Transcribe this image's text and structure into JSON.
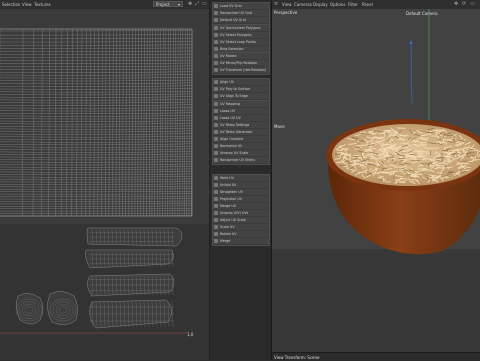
{
  "uv_editor": {
    "menu": [
      "Selection",
      "View",
      "Textures"
    ],
    "dropdown": "Project",
    "coordinate": "1,0"
  },
  "tool_groups": [
    [
      "Load UV Grid",
      "Randomize UV Grid",
      "Default UV Grid"
    ],
    [
      "UV Quickselect Polygons",
      "UV Select Polygons",
      "UV Select Loop Points",
      "Ring Selection"
    ],
    [
      "UV Rotate",
      "UV Mirror/Flip Rotation",
      "UV Transform (Hot Rotation)"
    ],
    [
      "Align UV",
      "UV Poly to Surface",
      "UV Align To Edge"
    ],
    [
      "UV Mapping",
      "Lasso UV",
      "Lasso UV UV",
      "UV Relax Settings",
      "UV Relax Generator",
      "Align Unrolled",
      "Normalize UV",
      "Unwrap UV Scale",
      "Randomize UV Shells"
    ],
    [
      "Weld UV",
      "Unfold UV",
      "Straighten UV",
      "Projection UV",
      "Merge UV",
      "Unwrap (UV) UVs",
      "Adjust UV Scale",
      "Scale UV",
      "Rotate UV",
      "Merge"
    ]
  ],
  "viewport": {
    "menu": [
      "View",
      "Cameras",
      "Display",
      "Options",
      "Filter",
      "Panel"
    ],
    "perspective_label": "Perspective",
    "camera_label": "Default Camera",
    "move_label": "Move",
    "status_text": "View Transform: Scene"
  },
  "colors": {
    "bowl": "#8a3f16",
    "bowl_dark": "#5b2709",
    "rice": "#d9b98a",
    "uv_wire": "#8a8a8a",
    "axis_green": "#5fae63",
    "axis_blue": "#3f6fd0"
  }
}
